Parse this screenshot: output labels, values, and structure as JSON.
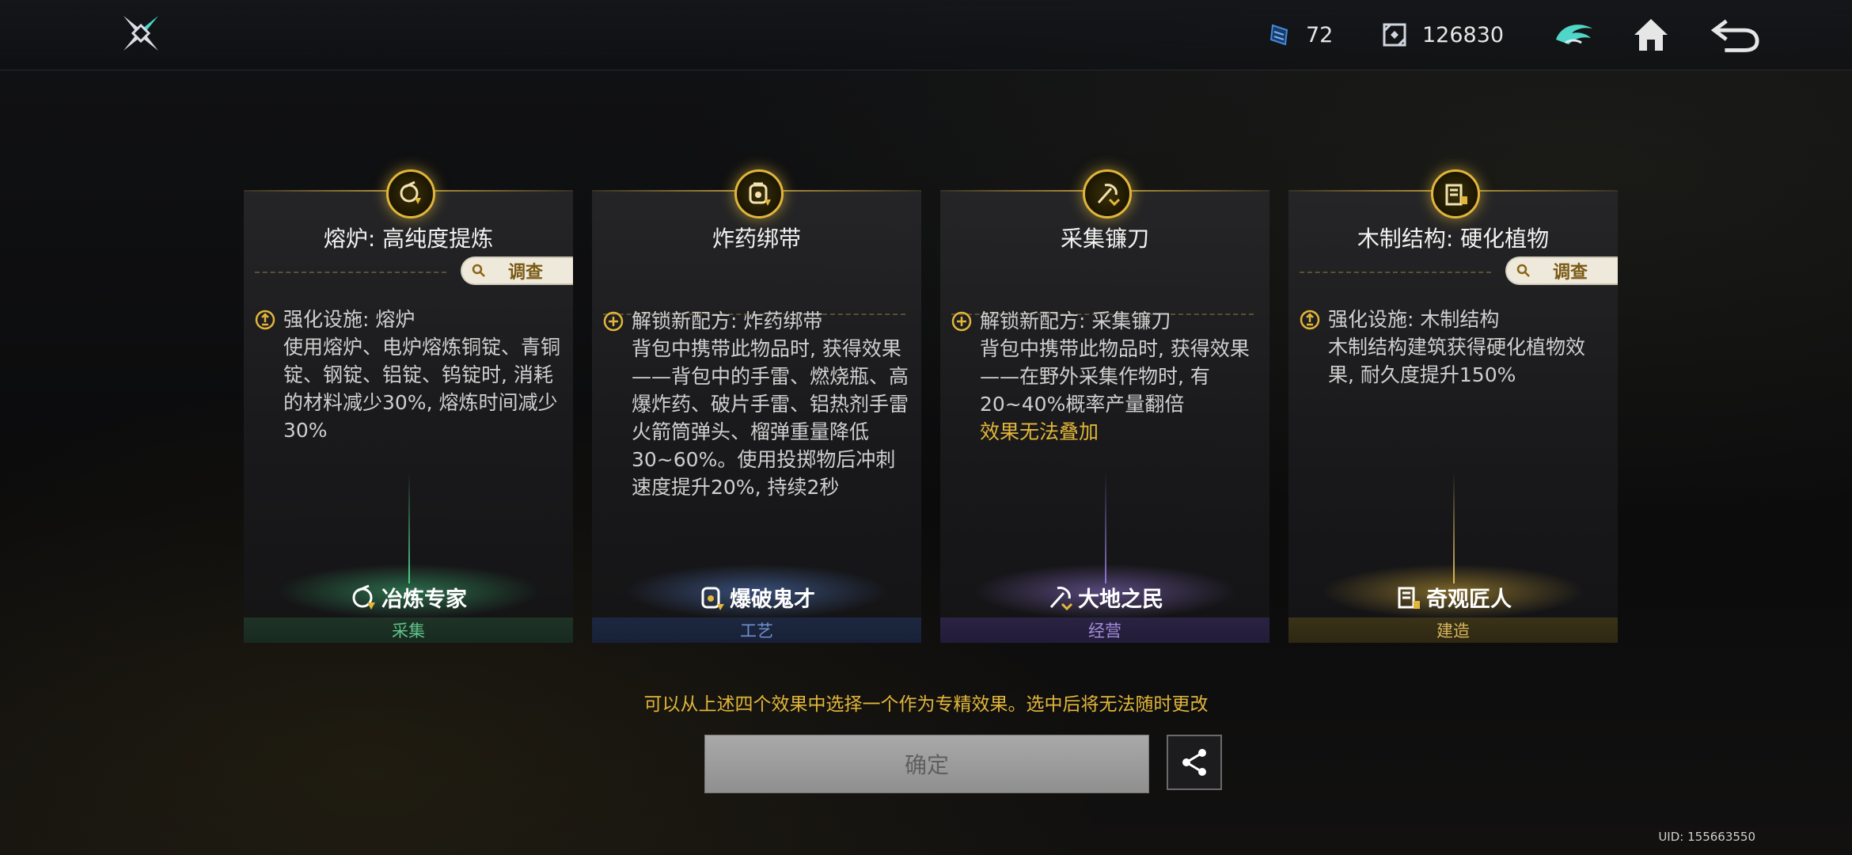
{
  "topbar": {
    "resource1": {
      "icon": "blue-chip-icon",
      "value": "72"
    },
    "resource2": {
      "icon": "square-gem-icon",
      "value": "126830"
    }
  },
  "cards": [
    {
      "title": "熔炉: 高纯度提炼",
      "investigate": "调查",
      "heading": "强化设施: 熔炉",
      "body": "使用熔炉、电炉熔炼铜锭、青铜锭、钢锭、铝锭、钨锭时, 消耗的材料减少30%, 熔炼时间减少30%",
      "skill": "冶炼专家",
      "category": "采集",
      "accent": "#46d68a"
    },
    {
      "title": "炸药绑带",
      "heading": "解锁新配方: 炸药绑带",
      "body": "背包中携带此物品时, 获得效果——背包中的手雷、燃烧瓶、高爆炸药、破片手雷、铝热剂手雷火箭筒弹头、榴弹重量降低30~60%。使用投掷物后冲刺速度提升20%, 持续2秒",
      "skill": "爆破鬼才",
      "category": "工艺",
      "accent": "#5a86d8"
    },
    {
      "title": "采集镰刀",
      "heading": "解锁新配方: 采集镰刀",
      "body": "背包中携带此物品时, 获得效果——在野外采集作物时, 有20~40%概率产量翻倍",
      "warning": "效果无法叠加",
      "skill": "大地之民",
      "category": "经营",
      "accent": "#9a7ae0"
    },
    {
      "title": "木制结构: 硬化植物",
      "investigate": "调查",
      "heading": "强化设施: 木制结构",
      "body": "木制结构建筑获得硬化植物效果, 耐久度提升150%",
      "skill": "奇观匠人",
      "category": "建造",
      "accent": "#e2b63a"
    }
  ],
  "hint": "可以从上述四个效果中选择一个作为专精效果。选中后将无法随时更改",
  "confirm_label": "确定",
  "uid": "UID: 155663550",
  "colors": {
    "gold": "#e2b63a",
    "bg": "#0d0e10"
  }
}
